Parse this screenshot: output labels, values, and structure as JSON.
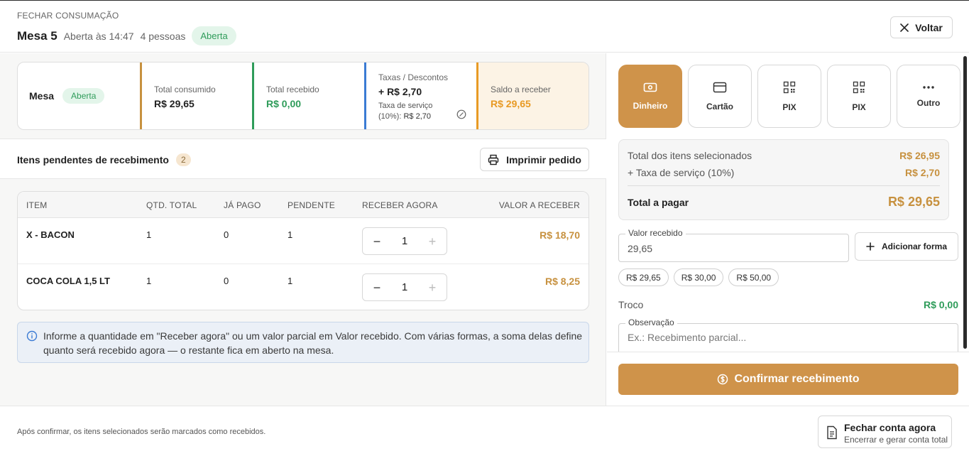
{
  "header": {
    "eyebrow": "FECHAR CONSUMAÇÃO",
    "title": "Mesa 5",
    "opened_at": "Aberta às 14:47",
    "people": "4 pessoas",
    "status": "Aberta",
    "back_label": "Voltar"
  },
  "summary": {
    "mesa_label": "Mesa",
    "mesa_status": "Aberta",
    "total_consumido_label": "Total consumido",
    "total_consumido": "R$ 29,65",
    "total_recebido_label": "Total recebido",
    "total_recebido": "R$ 0,00",
    "taxas_label": "Taxas / Descontos",
    "taxas_value": "+ R$ 2,70",
    "taxa_servico_label": "Taxa de serviço (10%):",
    "taxa_servico_value": "R$ 2,70",
    "saldo_label": "Saldo a receber",
    "saldo_value": "R$ 29,65",
    "colors": {
      "consumido": "#c7913f",
      "recebido": "#2f9c5a",
      "taxas": "#3b7bd4",
      "saldo": "#e89a24"
    }
  },
  "pending": {
    "title": "Itens pendentes de recebimento",
    "count": "2",
    "print_label": "Imprimir pedido"
  },
  "table": {
    "headers": {
      "item": "ITEM",
      "qtd_total": "QTD. TOTAL",
      "ja_pago": "JÁ PAGO",
      "pendente": "PENDENTE",
      "receber_agora": "RECEBER AGORA",
      "valor_a_receber": "VALOR A RECEBER"
    },
    "rows": [
      {
        "item": "X - BACON",
        "qtd_total": "1",
        "ja_pago": "0",
        "pendente": "1",
        "receber_agora": "1",
        "valor": "R$ 18,70"
      },
      {
        "item": "COCA COLA 1,5 LT",
        "qtd_total": "1",
        "ja_pago": "0",
        "pendente": "1",
        "receber_agora": "1",
        "valor": "R$ 8,25"
      }
    ]
  },
  "info": {
    "text": "Informe a quantidade em \"Receber agora\" ou um valor parcial em Valor recebido. Com várias formas, a soma delas define quanto será recebido agora — o restante fica em aberto na mesa."
  },
  "payment": {
    "methods": [
      {
        "label": "Dinheiro",
        "icon": "cash-icon",
        "active": true
      },
      {
        "label": "Cartão",
        "icon": "card-icon",
        "active": false
      },
      {
        "label": "PIX",
        "icon": "qr-icon",
        "active": false
      },
      {
        "label": "PIX",
        "icon": "qr-icon",
        "active": false
      },
      {
        "label": "Outro",
        "icon": "more-icon",
        "active": false
      }
    ],
    "totals": {
      "itens_label": "Total dos itens selecionados",
      "itens_value": "R$ 26,95",
      "taxa_label": "+ Taxa de serviço (10%)",
      "taxa_value": "R$ 2,70",
      "pagar_label": "Total a pagar",
      "pagar_value": "R$ 29,65"
    },
    "valor_recebido_label": "Valor recebido",
    "valor_recebido": "29,65",
    "add_form_label": "Adicionar forma",
    "quick_amounts": [
      "R$ 29,65",
      "R$ 30,00",
      "R$ 50,00"
    ],
    "troco_label": "Troco",
    "troco_value": "R$ 0,00",
    "observacao_label": "Observação",
    "observacao_placeholder": "Ex.: Recebimento parcial...",
    "confirm_label": "Confirmar recebimento",
    "accent": "#cf934a"
  },
  "bottom": {
    "note": "Após confirmar, os itens selecionados serão marcados como recebidos.",
    "close_title": "Fechar conta agora",
    "close_subtitle": "Encerrar e gerar conta total"
  }
}
